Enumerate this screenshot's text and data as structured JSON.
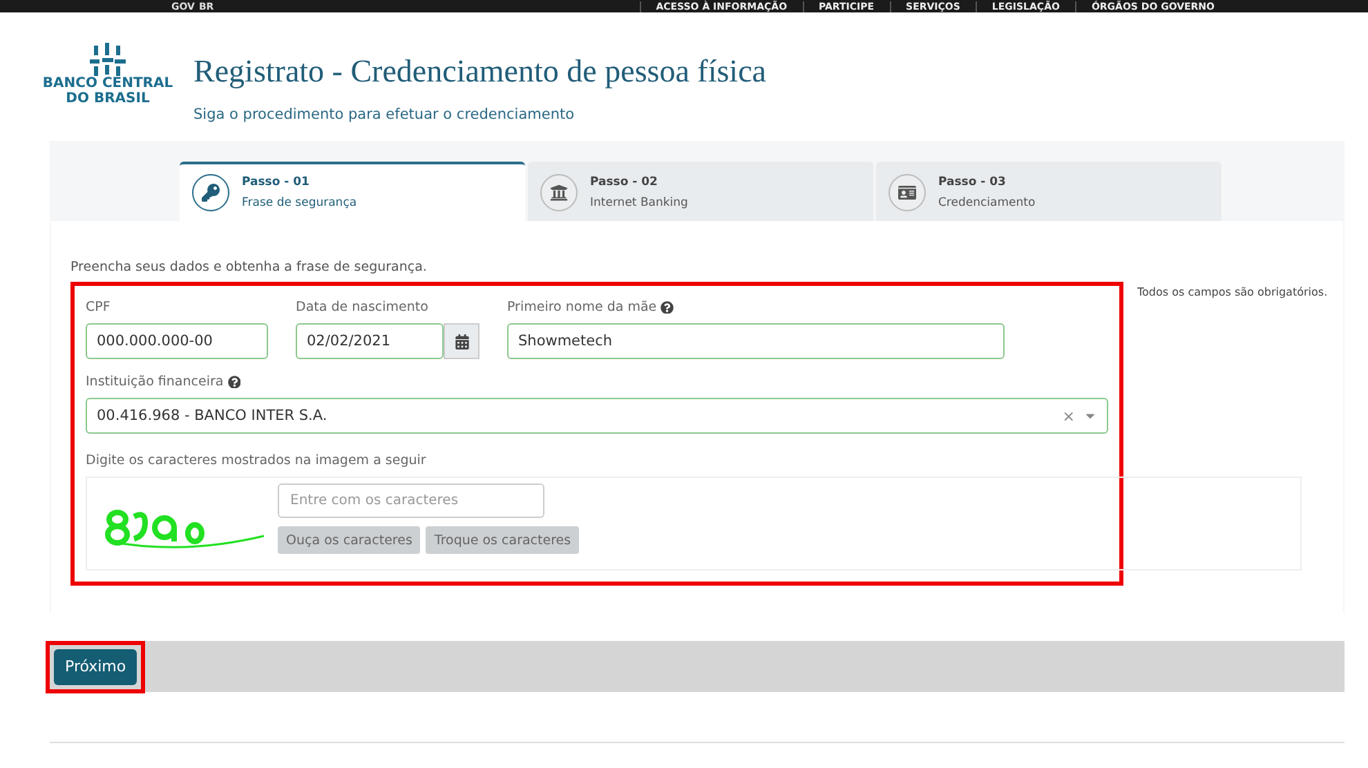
{
  "top_bar": {
    "logo": [
      "GOV",
      "BR"
    ],
    "links": [
      "ACESSO À INFORMAÇÃO",
      "PARTICIPE",
      "SERVIÇOS",
      "LEGISLAÇÃO",
      "ÓRGÃOS DO GOVERNO"
    ]
  },
  "header": {
    "logo_lines": [
      "BANCO CENTRAL",
      "DO BRASIL"
    ],
    "title": "Registrato - Credenciamento de pessoa física",
    "subtitle": "Siga o procedimento para efetuar o credenciamento"
  },
  "steps": [
    {
      "kind": "key",
      "step": "Passo - 01",
      "label": "Frase de segurança",
      "selected": true
    },
    {
      "kind": "bank",
      "step": "Passo - 02",
      "label": "Internet Banking",
      "selected": false
    },
    {
      "kind": "card",
      "step": "Passo - 03",
      "label": "Credenciamento",
      "selected": false
    }
  ],
  "intro": "Preencha seus dados e obtenha a frase de segurança.",
  "required_note": "Todos os campos são obrigatórios.",
  "form": {
    "highlighted": true,
    "cpf": {
      "label": "CPF",
      "value": "000.000.000-00"
    },
    "birth": {
      "label": "Data de nascimento",
      "value": "02/02/2021"
    },
    "mother": {
      "label": "Primeiro nome da mãe",
      "value": "Showmetech"
    },
    "institution": {
      "label": "Instituição financeira",
      "value": "00.416.968 - BANCO INTER S.A.",
      "clear": "×"
    },
    "captcha": {
      "label": "Digite os caracteres mostrados na imagem a seguir",
      "placeholder": "Entre com os caracteres",
      "buttons": [
        "Ouça os caracteres",
        "Troque os caracteres"
      ]
    }
  },
  "next_button": {
    "label": "Próximo",
    "highlighted": true
  }
}
